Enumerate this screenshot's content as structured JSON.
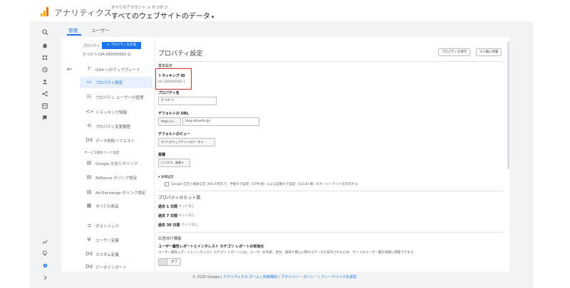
{
  "header": {
    "app_title": "アナリティクス",
    "account_path": "すべてのアカウント > かつかつ",
    "view_title": "すべてのウェブサイトのデータ",
    "view_caret": "▾",
    "brand_colors": [
      "#f9ab00",
      "#e37400"
    ]
  },
  "rail": {
    "icons": [
      "search-icon",
      "home-icon",
      "dashboard-icon",
      "clock-icon",
      "person-icon",
      "acquisition-icon",
      "behavior-icon",
      "flag-icon",
      "discover-icon",
      "lightbulb-icon",
      "gear-icon",
      "expand-icon"
    ]
  },
  "tabs": {
    "admin": "管理",
    "user": "ユーザー"
  },
  "property_column": {
    "label": "プロパティ",
    "create_button": "+ プロパティを作成",
    "property_name": "かつかつ (UA-183056582-1)",
    "back_icon": "←",
    "items": [
      {
        "icon": "↑",
        "label": "GA4 へのアップグレード"
      },
      {
        "icon": "▭",
        "label": "プロパティ設定"
      },
      {
        "icon": "☷",
        "label": "プロパティ ユーザーの管理"
      },
      {
        "icon": "<>",
        "label": "トラッキング情報"
      },
      {
        "icon": "⟲",
        "label": "プロパティ変更履歴"
      },
      {
        "icon": "Dd",
        "label": "データ削除リクエスト"
      }
    ],
    "section_heading": "サービス間のリンク設定",
    "link_items": [
      {
        "icon": "▤",
        "label": "Google 広告とのリンク"
      },
      {
        "icon": "▤",
        "label": "AdSense のリンク設定"
      },
      {
        "icon": "▤",
        "label": "Ad Exchange のリンク設定"
      },
      {
        "icon": "▦",
        "label": "すべての商品"
      }
    ],
    "more_items": [
      {
        "icon": "⊐",
        "label": "ポストバック"
      },
      {
        "icon": "Ψ",
        "label": "ユーザー定義"
      },
      {
        "icon": "Dd",
        "label": "カスタム定義"
      },
      {
        "icon": "Dd",
        "label": "データインポート"
      }
    ]
  },
  "panel": {
    "title": "プロパティ設定",
    "trash_button": "プロパティを移行",
    "trash2_button": "ゴミ箱に移動",
    "basic_settings": "基本設定",
    "tracking_id_label": "トラッキング ID",
    "tracking_id": "UA-183056582-1",
    "property_name_label": "プロパティ名",
    "property_name_value": "かつかつ",
    "default_url_label": "デフォルトの URL",
    "protocol": "https:// ▾",
    "default_url_value": "blog.aitueito.jp/",
    "default_view_label": "デフォルトのビュー",
    "default_view_value": "すべてのウェブサイトのデータ ▾",
    "industry_label": "業種",
    "industry_value": "ビジネス、産業 ▾",
    "advanced_label": "▾ 詳細設定",
    "advanced_option": "Google 広告と検索広告 360 の両方で、手動タグ設定（UTM 値）による自動タグ設定（GCLID 値）のオーバーライドを許可する",
    "hits_heading": "プロパティのヒット数",
    "hits": [
      {
        "period": "過去 1 日間",
        "value": "ヒットなし"
      },
      {
        "period": "過去 7 日間",
        "value": "ヒットなし"
      },
      {
        "period": "過去 30 日間",
        "value": "ヒットなし"
      }
    ],
    "ads_heading": "広告向け機能",
    "ads_feature_title": "ユーザー属性レポートとインタレスト カテゴリ レポートの有効化",
    "ads_feature_desc": "ユーザー属性レポートとインタレスト カテゴリ レポートには、ユーザーの年齢、性別、興味や関心に関するデータが表示されるため、サイトのユーザー層を的確に把握できます。",
    "toggle_state": "オフ"
  },
  "footer": {
    "copyright": "© 2020 Google",
    "links": [
      "アナリティクス ホーム",
      "利用規約",
      "プライバシー ポリシー",
      "フィードバックを送信"
    ]
  }
}
